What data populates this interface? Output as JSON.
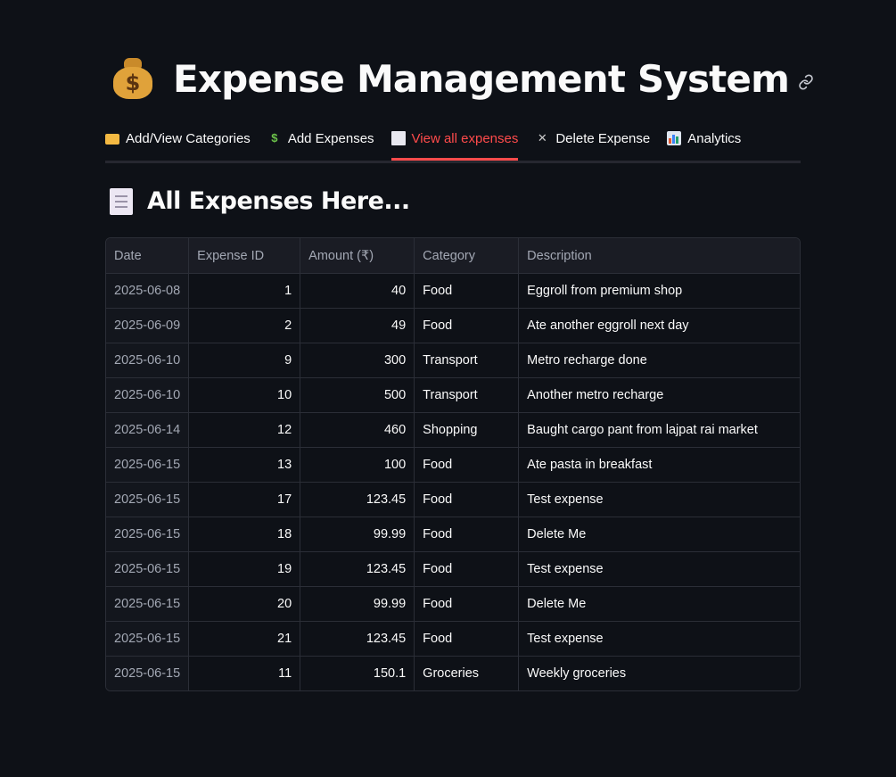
{
  "header": {
    "title": "Expense Management System",
    "title_icon": "money-bag-icon",
    "anchor_icon": "link-icon"
  },
  "tabs": [
    {
      "label": "Add/View Categories",
      "icon": "folder-icon",
      "active": false
    },
    {
      "label": "Add Expenses",
      "icon": "money-wings-icon",
      "active": false
    },
    {
      "label": "View all expenses",
      "icon": "receipt-icon",
      "active": true
    },
    {
      "label": "Delete Expense",
      "icon": "tools-icon",
      "active": false
    },
    {
      "label": "Analytics",
      "icon": "bar-chart-icon",
      "active": false
    }
  ],
  "section": {
    "title": "All Expenses Here...",
    "icon": "receipt-icon"
  },
  "table": {
    "columns": [
      "Date",
      "Expense ID",
      "Amount (₹)",
      "Category",
      "Description"
    ],
    "rows": [
      [
        "2025-06-08",
        "1",
        "40",
        "Food",
        "Eggroll from premium shop"
      ],
      [
        "2025-06-09",
        "2",
        "49",
        "Food",
        "Ate another eggroll next day"
      ],
      [
        "2025-06-10",
        "9",
        "300",
        "Transport",
        "Metro recharge done"
      ],
      [
        "2025-06-10",
        "10",
        "500",
        "Transport",
        "Another metro recharge"
      ],
      [
        "2025-06-14",
        "12",
        "460",
        "Shopping",
        "Baught cargo pant from lajpat rai market"
      ],
      [
        "2025-06-15",
        "13",
        "100",
        "Food",
        "Ate pasta in breakfast"
      ],
      [
        "2025-06-15",
        "17",
        "123.45",
        "Food",
        "Test expense"
      ],
      [
        "2025-06-15",
        "18",
        "99.99",
        "Food",
        "Delete Me"
      ],
      [
        "2025-06-15",
        "19",
        "123.45",
        "Food",
        "Test expense"
      ],
      [
        "2025-06-15",
        "20",
        "99.99",
        "Food",
        "Delete Me"
      ],
      [
        "2025-06-15",
        "21",
        "123.45",
        "Food",
        "Test expense"
      ],
      [
        "2025-06-15",
        "11",
        "150.1",
        "Groceries",
        "Weekly groceries"
      ]
    ]
  },
  "colors": {
    "background": "#0e1117",
    "accent": "#ff4b4b",
    "text": "#fafafa",
    "muted": "#a3a8b4"
  }
}
